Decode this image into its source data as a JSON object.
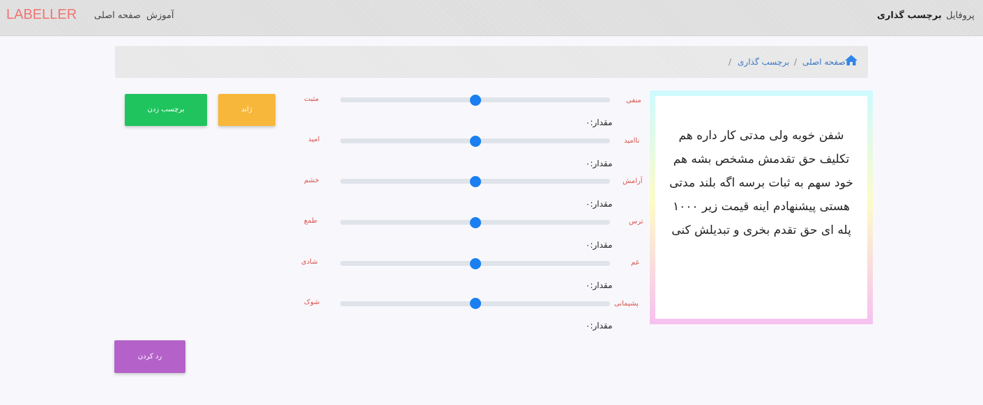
{
  "navbar": {
    "brand": "LABELLER",
    "left_links": [
      "صفحه اصلی",
      "آموزش"
    ],
    "right_links": [
      "پروفایل",
      "برچسب گذاری"
    ]
  },
  "breadcrumb": {
    "home": "صفحه اصلی",
    "current": "برچسب گذاری",
    "separator": "/"
  },
  "text_card": {
    "text": "شفن خوبه ولی مدتی کار داره هم تکلیف حق تقدمش مشخص بشه هم خود سهم به ثبات برسه اگه بلند مدتی هستی پیشنهادم اینه قیمت زیر ۱۰۰۰ پله ای حق تقدم بخری و تبدیلش کنی"
  },
  "sliders": [
    {
      "right": "منفی",
      "left": "مثبت",
      "value_text": "مقدار:۰"
    },
    {
      "right": "ناامید",
      "left": "امید",
      "value_text": "مقدار:۰"
    },
    {
      "right": "آرامش",
      "left": "خشم",
      "value_text": "مقدار:۰"
    },
    {
      "right": "ترس",
      "left": "طمع",
      "value_text": "مقدار:۰"
    },
    {
      "right": "غم",
      "left": "شادی",
      "value_text": "مقدار:۰"
    },
    {
      "right": "پشیمانی",
      "left": "شوک",
      "value_text": "مقدار:۰"
    }
  ],
  "buttons": {
    "skip": "ژاند",
    "label": "برچسب زدن",
    "reject": "رد کردن"
  },
  "colors": {
    "brand": "#f07470",
    "slider_thumb": "#1a7ff0",
    "btn_skip": "#f7b73a",
    "btn_label": "#1fc45e",
    "btn_reject": "#b462c9"
  }
}
